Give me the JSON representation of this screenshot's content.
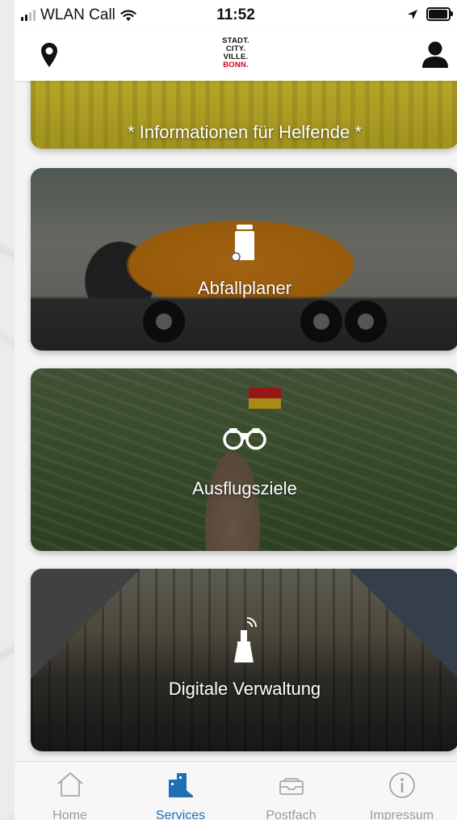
{
  "status_bar": {
    "carrier": "WLAN Call",
    "time": "11:52",
    "battery_level": 0.9
  },
  "header": {
    "location_icon": "location-pin-icon",
    "logo_lines": [
      "STADT.",
      "CITY.",
      "VILLE.",
      "BONN."
    ],
    "profile_icon": "user-icon"
  },
  "cards": [
    {
      "label": "* Informationen für Helfende *",
      "icon": "none"
    },
    {
      "label": "Abfallplaner",
      "icon": "trash-bin-icon"
    },
    {
      "label": "Ausflugsziele",
      "icon": "binoculars-icon"
    },
    {
      "label": "Digitale Verwaltung",
      "icon": "signal-tower-icon"
    }
  ],
  "tabs": [
    {
      "label": "Home",
      "icon": "home-icon",
      "active": false
    },
    {
      "label": "Services",
      "icon": "buildings-icon",
      "active": true
    },
    {
      "label": "Postfach",
      "icon": "mailbox-icon",
      "active": false
    },
    {
      "label": "Impressum",
      "icon": "info-icon",
      "active": false
    }
  ],
  "colors": {
    "accent": "#1f6fb5",
    "inactive": "#9b9b9b",
    "logo_red": "#d6001c"
  }
}
